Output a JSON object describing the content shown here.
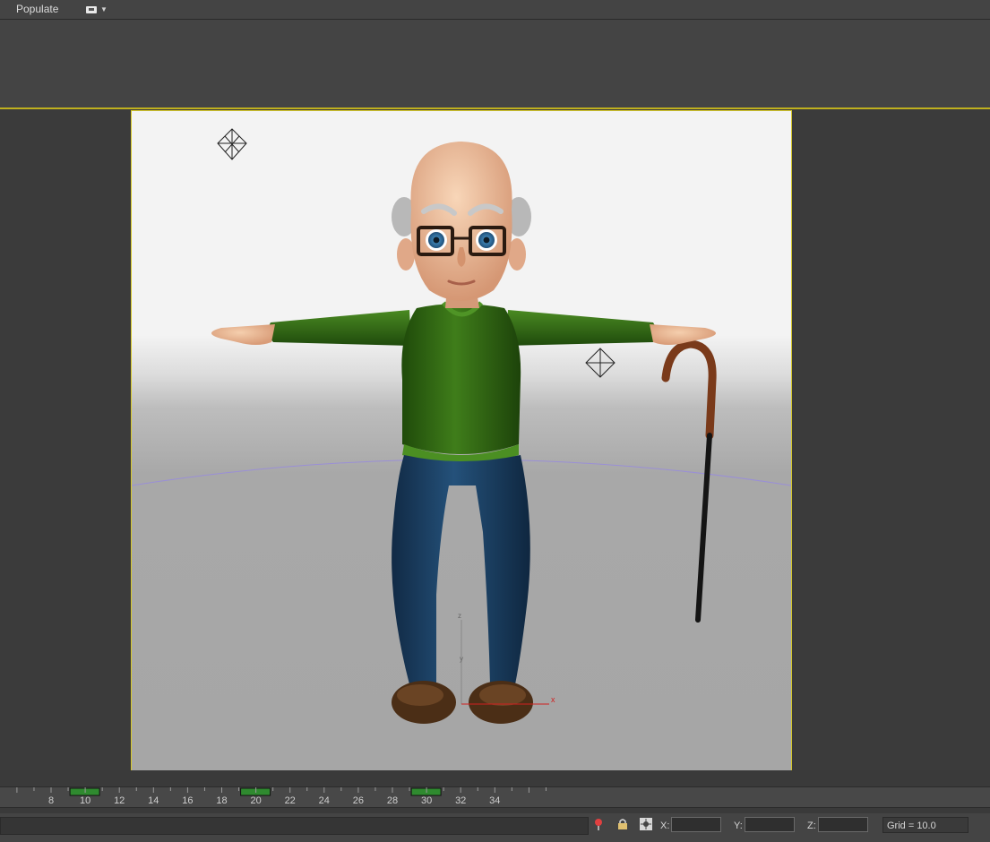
{
  "menu": {
    "populate_label": "Populate",
    "layout_icon": "viewport-layout-icon"
  },
  "viewport": {
    "axis_labels": {
      "x": "x",
      "y": "y",
      "z": "z"
    },
    "background_top": "#f3f3f3",
    "background_bottom": "#a6a6a6",
    "border_color": "#d6c82a"
  },
  "timeline": {
    "frame_labels": [
      "8",
      "10",
      "12",
      "14",
      "16",
      "18",
      "20",
      "22",
      "24",
      "26",
      "28",
      "30",
      "32",
      "34"
    ],
    "keyframe_marker_color": "#2f8a2f"
  },
  "statusbar": {
    "x_label": "X:",
    "y_label": "Y:",
    "z_label": "Z:",
    "x_value": "",
    "y_value": "",
    "z_value": "",
    "grid_text": "Grid = 10.0",
    "icons": [
      "isolate-selection-icon",
      "selection-lock-icon",
      "absolute-mode-icon"
    ]
  }
}
